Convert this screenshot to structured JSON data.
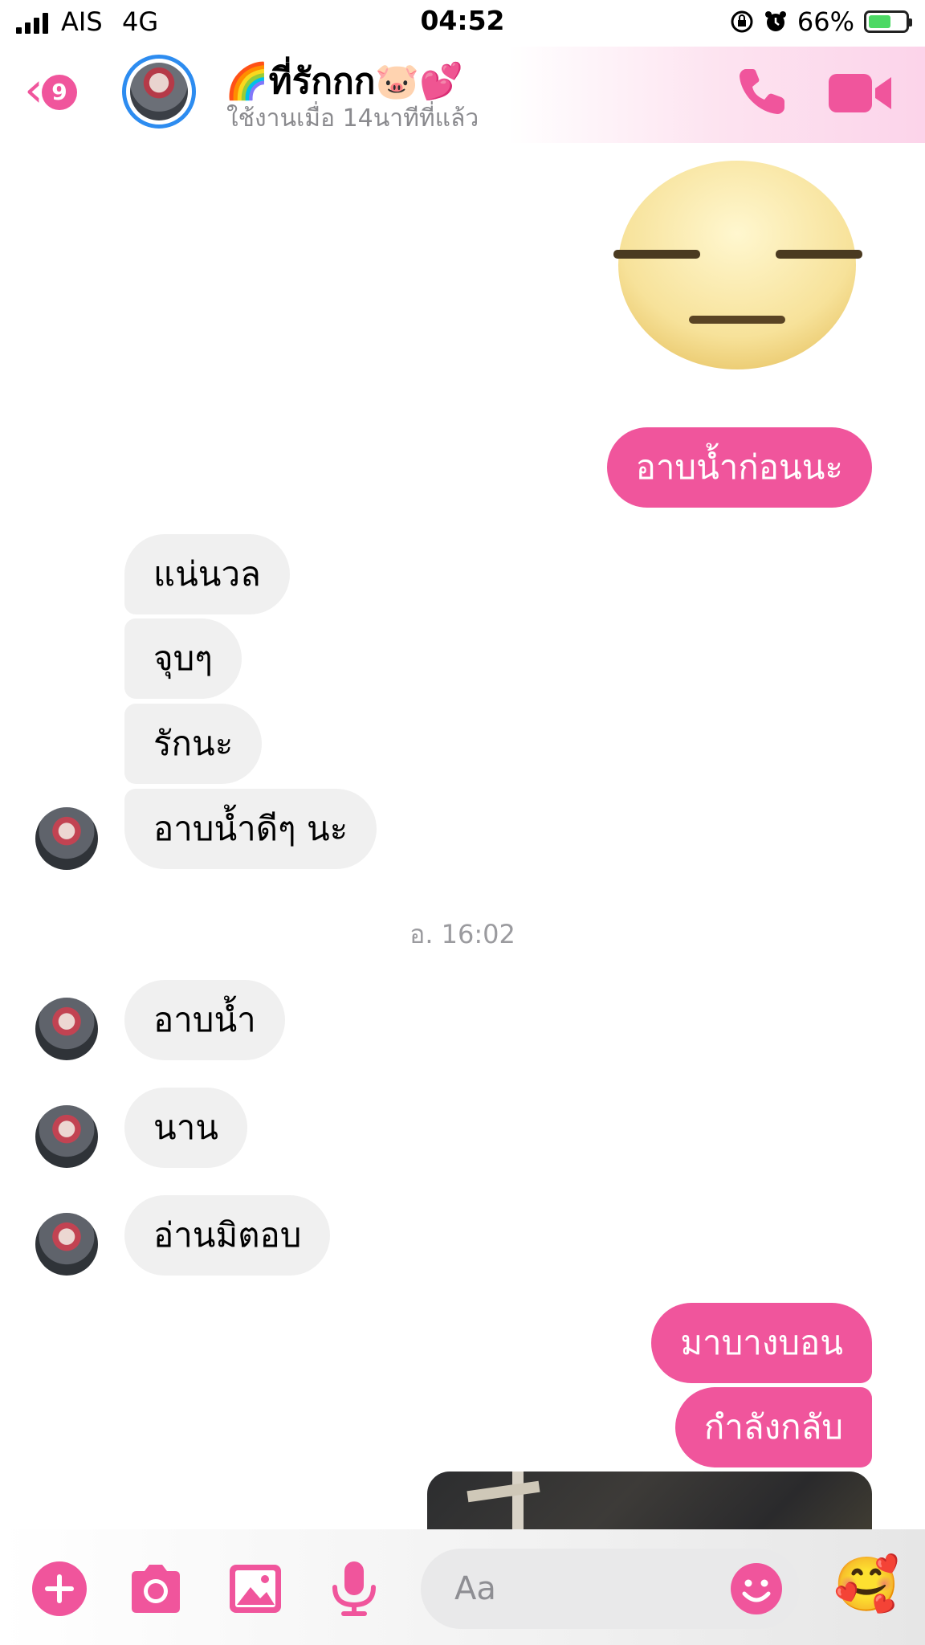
{
  "status_bar": {
    "carrier": "AIS",
    "network": "4G",
    "time": "04:52",
    "battery_percent": "66%",
    "battery_level": 0.66
  },
  "header": {
    "back_badge": "9",
    "contact_name": "🌈ที่รักกก🐷💕",
    "contact_status": "ใช้งานเมื่อ 14นาทีที่แล้ว",
    "accent_color": "#f0559c"
  },
  "messages": {
    "out_1": "อาบน้ำก่อนนะ",
    "in_1": "แน่นวล",
    "in_2": "จุบๆ",
    "in_3": "รักนะ",
    "in_4": "อาบน้ำดีๆ นะ",
    "timestamp": "อ. 16:02",
    "in_5": "อาบน้ำ",
    "in_6": "นาน",
    "in_7": "อ่านมิตอบ",
    "out_2": "มาบางบอน",
    "out_3": "กำลังกลับ"
  },
  "composer": {
    "placeholder": "Aa",
    "reaction_emoji": "🥰"
  },
  "icons": {
    "plus": "plus-icon",
    "camera": "camera-icon",
    "gallery": "image-icon",
    "mic": "microphone-icon",
    "smile": "smile-icon",
    "phone": "phone-icon",
    "video": "video-icon"
  }
}
